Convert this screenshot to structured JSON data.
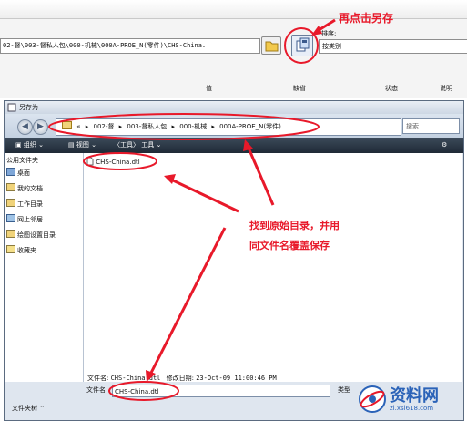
{
  "top_window": {
    "path_text": "02-督\\003-督私人包\\000-机械\\000A-PROE_N(零件)\\CHS-China.",
    "sort_label": "排序:",
    "sort_value": "按类别",
    "columns": [
      "值",
      "缺省",
      "状态",
      "说明"
    ]
  },
  "annotations": {
    "top": "再点击另存",
    "middle_line1": "找到原始目录，并用",
    "middle_line2": "同文件名覆盖保存"
  },
  "dialog": {
    "title": "另存为",
    "address": [
      "«",
      "002-督",
      "003-督私人包",
      "000-机械",
      "000A-PROE_N(零件)"
    ],
    "search_placeholder": "搜索...",
    "toolbar": {
      "organize": "组织",
      "views": "视图",
      "tools_bracket": "〈工具〉",
      "tools": "工具"
    },
    "sidebar": [
      "公用文件夹",
      "桌面",
      "我的文档",
      "工作目录",
      "网上邻居",
      "绘图设置目录",
      "收藏夹"
    ],
    "folder_toggle": "文件夹树",
    "file": "CHS-China.dtl",
    "info": {
      "name_label": "文件名:",
      "name_value": "CHS-China.dtl",
      "date_label": "修改日期:",
      "date_value": "23-Oct-09 11:00:46 PM"
    },
    "filename_label": "文件名",
    "filename_value": "CHS-China.dtl",
    "type_label": "类型"
  },
  "watermark": {
    "brand": "资料网",
    "url": "zl.xsl618.com"
  },
  "colors": {
    "accent_red": "#e8192a",
    "toolbar_dark": "#2a3644",
    "dialog_bg": "#dfe6ef"
  }
}
